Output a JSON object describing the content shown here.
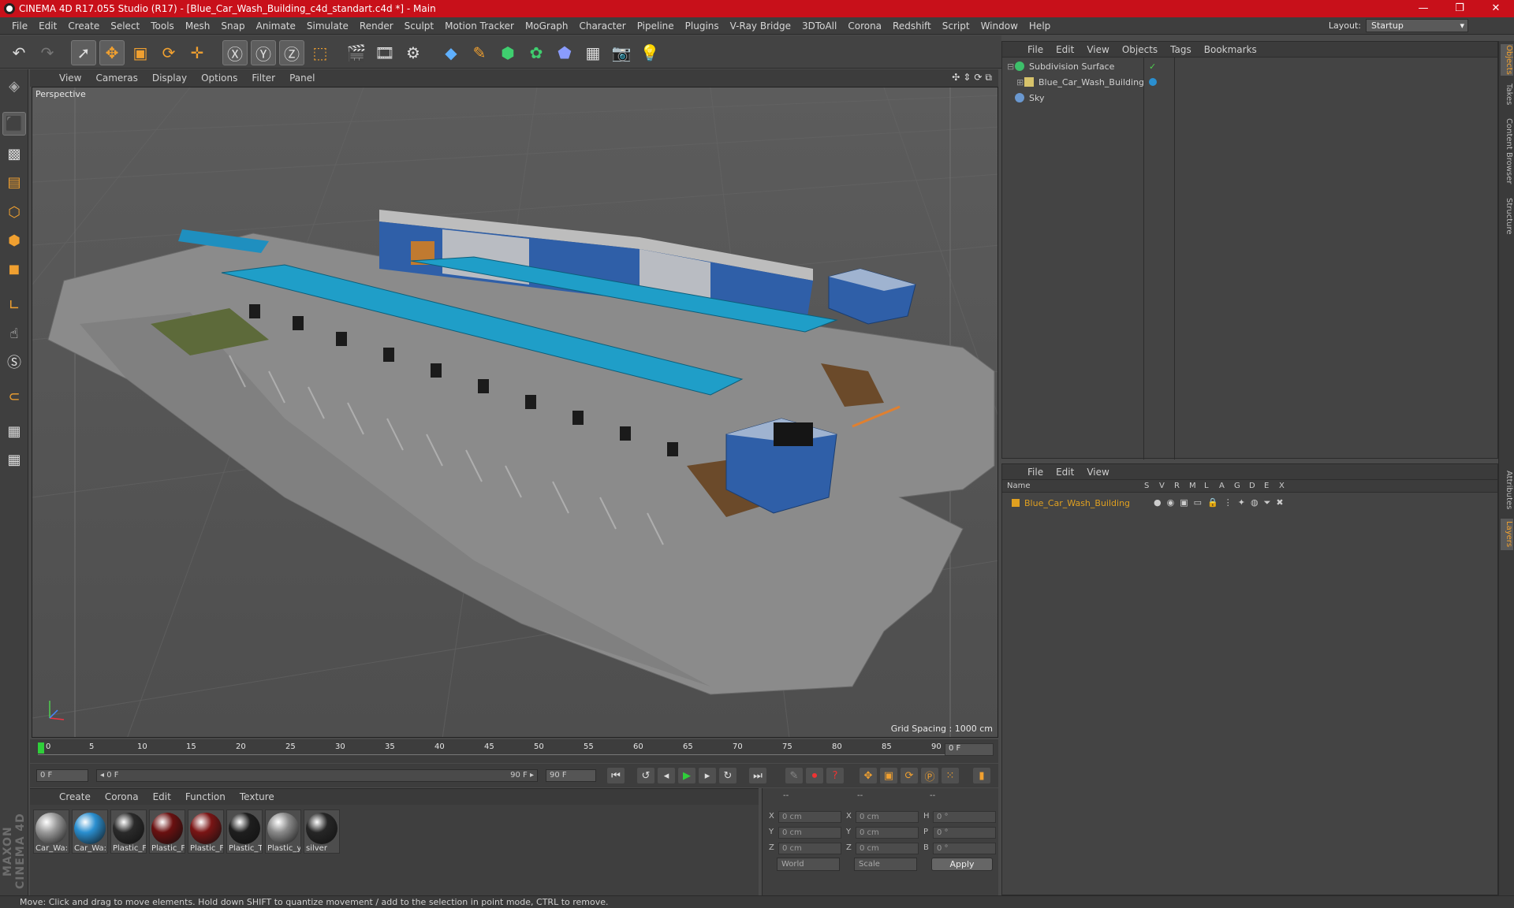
{
  "window": {
    "title": "CINEMA 4D R17.055 Studio (R17) - [Blue_Car_Wash_Building_c4d_standart.c4d *] - Main",
    "controls": [
      "—",
      "❐",
      "✕"
    ]
  },
  "menu": [
    "File",
    "Edit",
    "Create",
    "Select",
    "Tools",
    "Mesh",
    "Snap",
    "Animate",
    "Simulate",
    "Render",
    "Sculpt",
    "Motion Tracker",
    "MoGraph",
    "Character",
    "Pipeline",
    "Plugins",
    "V-Ray Bridge",
    "3DToAll",
    "Corona",
    "Redshift",
    "Script",
    "Window",
    "Help"
  ],
  "layout": {
    "label": "Layout:",
    "value": "Startup"
  },
  "viewport": {
    "menu": [
      "View",
      "Cameras",
      "Display",
      "Options",
      "Filter",
      "Panel"
    ],
    "label": "Perspective",
    "grid_spacing": "Grid Spacing : 1000 cm",
    "nav_glyphs": [
      "✣",
      "⇕",
      "⟳",
      "⧉"
    ]
  },
  "timeline": {
    "ticks": [
      "0",
      "5",
      "10",
      "15",
      "20",
      "25",
      "30",
      "35",
      "40",
      "45",
      "50",
      "55",
      "60",
      "65",
      "70",
      "75",
      "80",
      "85",
      "90"
    ],
    "current_frame": "0 F"
  },
  "transport": {
    "start": "0 F",
    "range_start": "◂ 0 F",
    "range_end": "90 F ▸",
    "end": "90 F"
  },
  "materials": {
    "menu": [
      "Create",
      "Corona",
      "Edit",
      "Function",
      "Texture"
    ],
    "items": [
      {
        "label": "Car_Wa:",
        "color": "#9a9a9a"
      },
      {
        "label": "Car_Wa:",
        "color": "#2a8fd0"
      },
      {
        "label": "Plastic_F",
        "color": "#2a2a2a"
      },
      {
        "label": "Plastic_F",
        "color": "#6a1010"
      },
      {
        "label": "Plastic_F",
        "color": "#7a1414"
      },
      {
        "label": "Plastic_T",
        "color": "#1e1e1e"
      },
      {
        "label": "Plastic_у",
        "color": "#8a8a8a"
      },
      {
        "label": "silver",
        "color": "#262626"
      }
    ]
  },
  "coords": {
    "header": [
      "--",
      "--",
      "--"
    ],
    "rows": [
      {
        "a": "X",
        "av": "0 cm",
        "b": "X",
        "bv": "0 cm",
        "c": "H",
        "cv": "0 °"
      },
      {
        "a": "Y",
        "av": "0 cm",
        "b": "Y",
        "bv": "0 cm",
        "c": "P",
        "cv": "0 °"
      },
      {
        "a": "Z",
        "av": "0 cm",
        "b": "Z",
        "bv": "0 cm",
        "c": "B",
        "cv": "0 °"
      }
    ],
    "mode1": "World",
    "mode2": "Scale",
    "apply": "Apply"
  },
  "objects": {
    "menu": [
      "File",
      "Edit",
      "View",
      "Objects",
      "Tags",
      "Bookmarks"
    ],
    "items": [
      {
        "name": "Subdivision Surface",
        "color": "#3dbf6a"
      },
      {
        "name": "Blue_Car_Wash_Building",
        "color": "#d7c36b"
      },
      {
        "name": "Sky",
        "color": "#6a98d0"
      }
    ]
  },
  "layers": {
    "menu": [
      "File",
      "Edit",
      "View"
    ],
    "columns": [
      "Name",
      "S",
      "V",
      "R",
      "M",
      "L",
      "A",
      "G",
      "D",
      "E",
      "X"
    ],
    "row": {
      "name": "Blue_Car_Wash_Building",
      "color": "#e0a020"
    }
  },
  "right_tabs": [
    "Objects",
    "Takes",
    "Content Browser",
    "Structure",
    "Attributes",
    "Layers"
  ],
  "status": "Move: Click and drag to move elements. Hold down SHIFT to quantize movement / add to the selection in point mode, CTRL to remove."
}
